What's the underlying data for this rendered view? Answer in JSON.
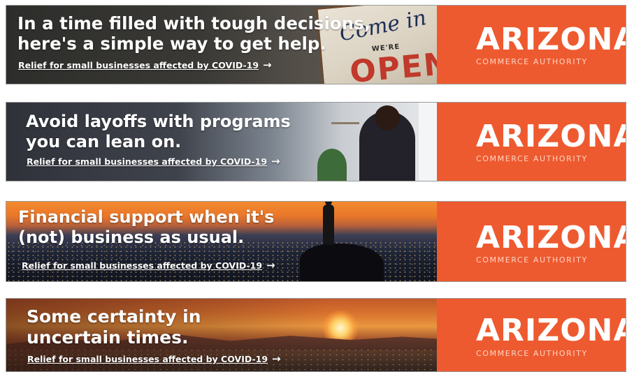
{
  "brand": {
    "name": "ARIZONA",
    "subtitle": "COMMERCE AUTHORITY",
    "color": "#ee5a2f"
  },
  "banners": [
    {
      "headline": [
        "In a time filled with tough decisions,",
        "here's a simple way to get help."
      ],
      "link": "Relief for small businesses affected by COVID-19",
      "arrow": "→",
      "sign": {
        "line1": "Come in",
        "line2": "WE'RE",
        "line3": "OPEN"
      }
    },
    {
      "headline": [
        "Avoid layoffs with programs",
        "you can lean on."
      ],
      "link": "Relief for small businesses affected by COVID-19",
      "arrow": "→"
    },
    {
      "headline": [
        "Financial support when it's",
        "(not) business as usual."
      ],
      "link": "Relief for small businesses affected by COVID-19",
      "arrow": "→"
    },
    {
      "headline": [
        "Some certainty in",
        "uncertain times."
      ],
      "link": "Relief for small businesses affected by COVID-19",
      "arrow": "→"
    }
  ]
}
